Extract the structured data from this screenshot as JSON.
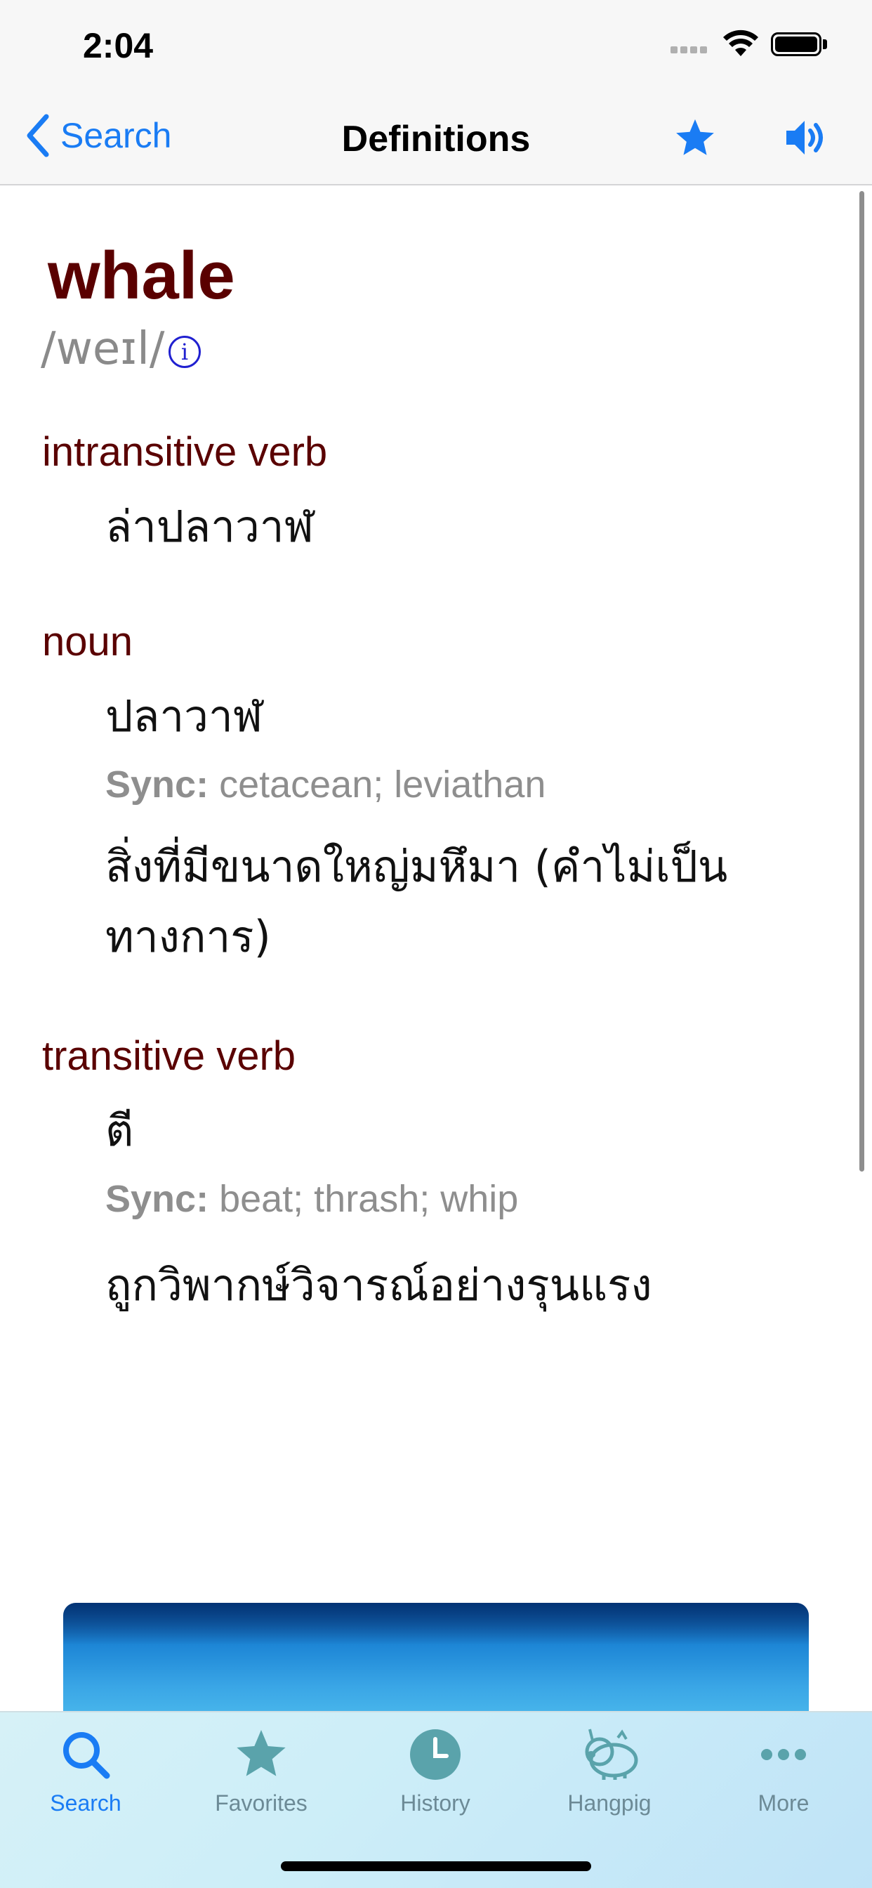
{
  "status": {
    "time": "2:04"
  },
  "nav": {
    "back_label": "Search",
    "title": "Definitions"
  },
  "entry": {
    "word": "whale",
    "pronunciation": "/weɪl/",
    "info_symbol": "i",
    "sections": [
      {
        "pos": "intransitive verb",
        "definition": "ล่าปลาวาฬ"
      },
      {
        "pos": "noun",
        "definition": "ปลาวาฬ",
        "sync_label": "Sync:",
        "sync": "cetacean; leviathan",
        "definition2": "สิ่งที่มีขนาดใหญ่มหึมา (คำไม่เป็นทางการ)"
      },
      {
        "pos": "transitive verb",
        "definition": "ตี",
        "sync_label": "Sync:",
        "sync": "beat; thrash; whip",
        "definition2": "ถูกวิพากษ์วิจารณ์อย่างรุนแรง"
      }
    ]
  },
  "tabs": [
    {
      "label": "Search",
      "icon": "search-icon",
      "active": true
    },
    {
      "label": "Favorites",
      "icon": "star-icon"
    },
    {
      "label": "History",
      "icon": "clock-icon"
    },
    {
      "label": "Hangpig",
      "icon": "pig-icon"
    },
    {
      "label": "More",
      "icon": "more-icon"
    }
  ],
  "colors": {
    "accent": "#1a7cf4",
    "headword": "#5a0000",
    "tab_inactive": "#6c8a96"
  }
}
